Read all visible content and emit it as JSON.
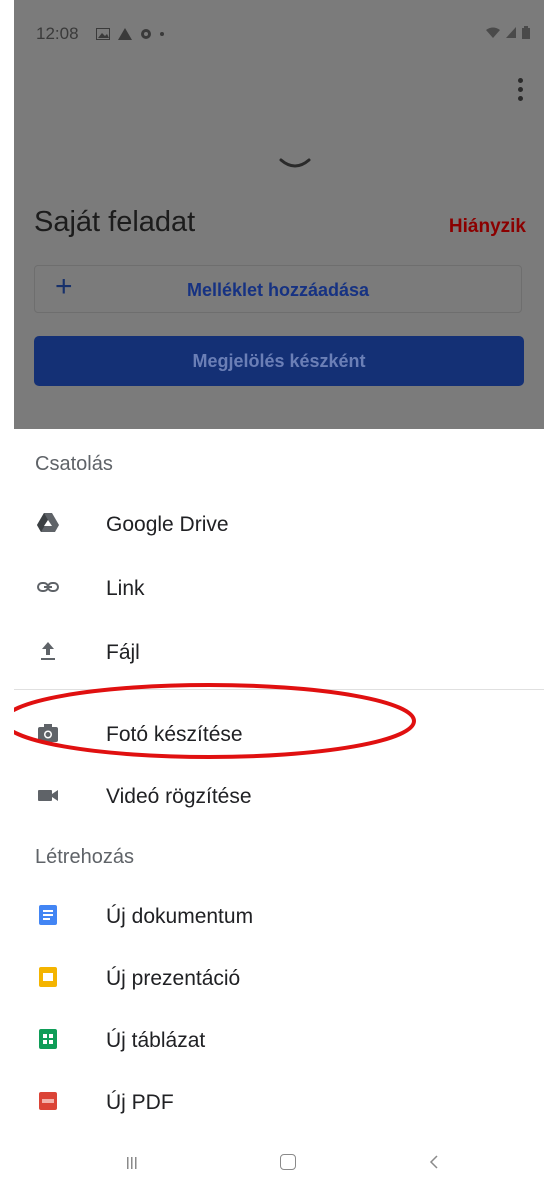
{
  "status_bar": {
    "time": "12:08"
  },
  "task": {
    "title": "Saját feladat",
    "status": "Hiányzik",
    "add_attachment_label": "Melléklet hozzáadása",
    "mark_done_label": "Megjelölés készként"
  },
  "sheet": {
    "attach_heading": "Csatolás",
    "attach_items": [
      {
        "label": "Google Drive",
        "icon": "google-drive-icon"
      },
      {
        "label": "Link",
        "icon": "link-icon"
      },
      {
        "label": "Fájl",
        "icon": "upload-file-icon"
      },
      {
        "label": "Fotó készítése",
        "icon": "camera-icon"
      },
      {
        "label": "Videó rögzítése",
        "icon": "video-camera-icon"
      }
    ],
    "create_heading": "Létrehozás",
    "create_items": [
      {
        "label": "Új dokumentum",
        "icon": "google-docs-icon",
        "color": "#4285f4"
      },
      {
        "label": "Új prezentáció",
        "icon": "google-slides-icon",
        "color": "#f4b400"
      },
      {
        "label": "Új táblázat",
        "icon": "google-sheets-icon",
        "color": "#0f9d58"
      },
      {
        "label": "Új PDF",
        "icon": "pdf-icon",
        "color": "#db4437"
      }
    ]
  },
  "colors": {
    "missing_status": "#8b0000",
    "primary_button": "#143075",
    "highlight_circle": "#e01010"
  }
}
